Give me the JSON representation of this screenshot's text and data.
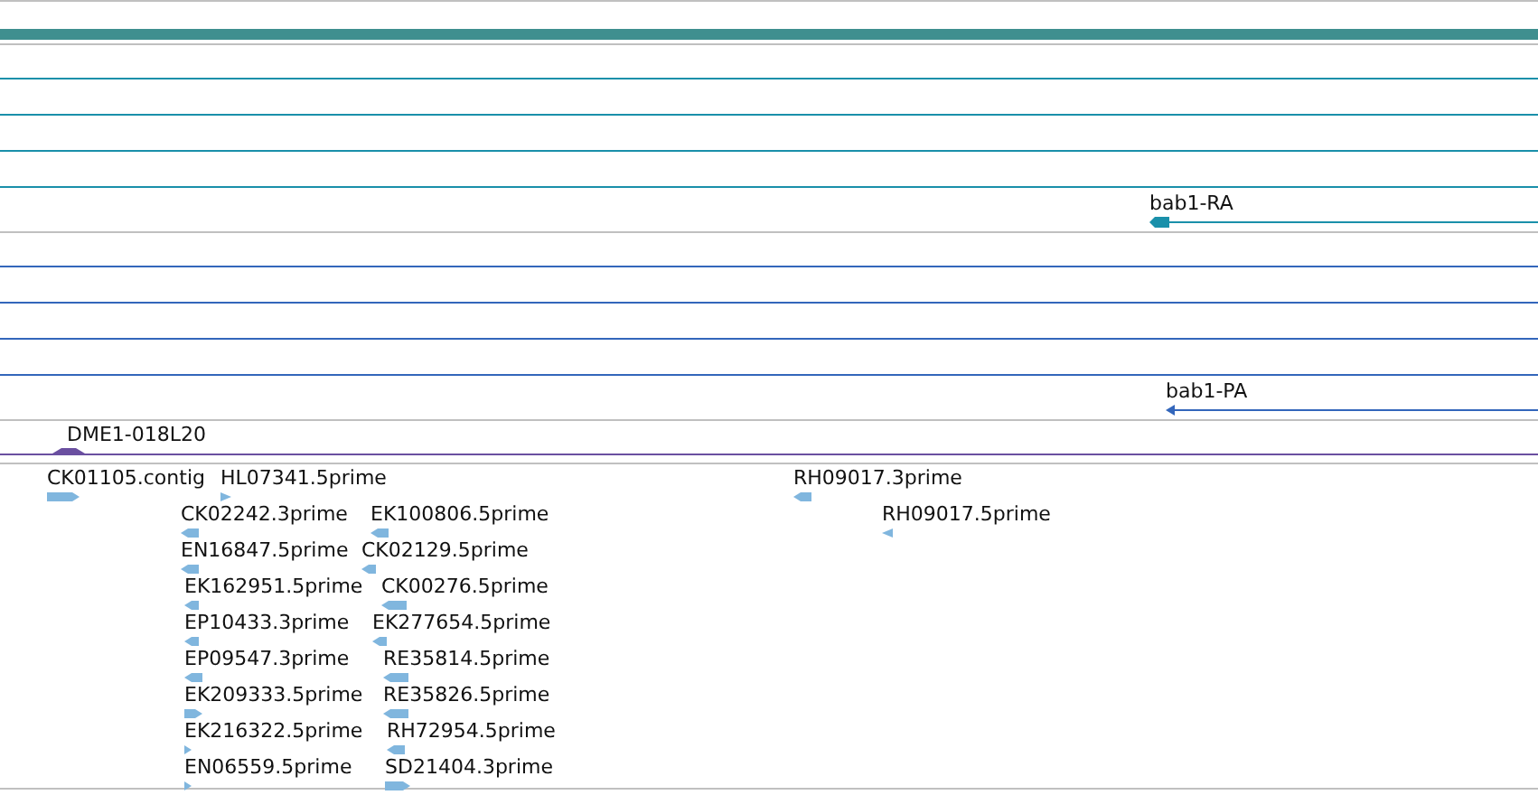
{
  "tracks": [
    {
      "kind": "transcript",
      "color": "#1a90aa",
      "features": [
        {
          "label": "bab1-RA",
          "reverse": true
        }
      ]
    },
    {
      "kind": "protein",
      "color": "#3366bb",
      "features": [
        {
          "label": "bab1-PA",
          "reverse": true
        }
      ]
    },
    {
      "kind": "clone",
      "color": "#6a4fa0",
      "features": [
        {
          "label": "DME1-018L20"
        }
      ]
    },
    {
      "kind": "est",
      "color": "#80b6de",
      "features": [
        {
          "label": "CK01105.contig",
          "reverse": false
        },
        {
          "label": "HL07341.5prime",
          "reverse": false
        },
        {
          "label": "CK02242.3prime",
          "reverse": true
        },
        {
          "label": "EK100806.5prime",
          "reverse": true
        },
        {
          "label": "EN16847.5prime",
          "reverse": true
        },
        {
          "label": "CK02129.5prime",
          "reverse": true
        },
        {
          "label": "EK162951.5prime",
          "reverse": true
        },
        {
          "label": "CK00276.5prime",
          "reverse": true
        },
        {
          "label": "EP10433.3prime",
          "reverse": true
        },
        {
          "label": "EK277654.5prime",
          "reverse": true
        },
        {
          "label": "EP09547.3prime",
          "reverse": true
        },
        {
          "label": "RE35814.5prime",
          "reverse": true
        },
        {
          "label": "EK209333.5prime",
          "reverse": false
        },
        {
          "label": "RE35826.5prime",
          "reverse": true
        },
        {
          "label": "EK216322.5prime",
          "reverse": false
        },
        {
          "label": "RH72954.5prime",
          "reverse": true
        },
        {
          "label": "EN06559.5prime",
          "reverse": false
        },
        {
          "label": "SD21404.3prime",
          "reverse": false
        },
        {
          "label": "RH09017.3prime",
          "reverse": true
        },
        {
          "label": "RH09017.5prime",
          "reverse": true
        }
      ]
    }
  ]
}
